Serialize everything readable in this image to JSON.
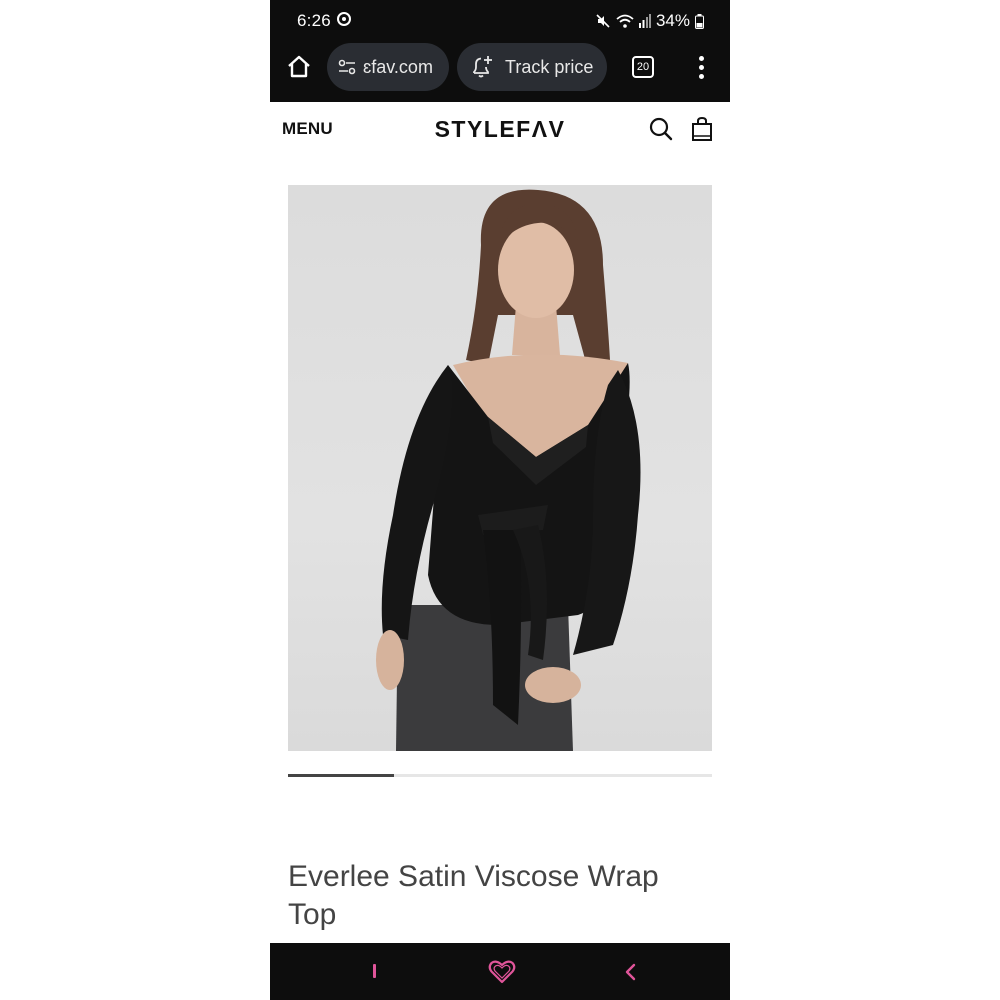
{
  "status_bar": {
    "time": "6:26",
    "battery": "34%"
  },
  "browser": {
    "url": "ɛfav.com",
    "track_price_label": "Track price",
    "tab_count": "20"
  },
  "site": {
    "menu_label": "MENU",
    "logo": "STYLEFΛV"
  },
  "product": {
    "title": "Everlee Satin Viscose Wrap Top",
    "carousel_progress": 0.25
  },
  "icons": {
    "status": [
      "sync-icon",
      "mute-icon",
      "wifi-icon",
      "signal-icon",
      "battery-icon"
    ],
    "browser": [
      "home-icon",
      "site-settings-icon",
      "bell-plus-icon",
      "tabs-icon",
      "more-icon"
    ],
    "site": [
      "search-icon",
      "bag-icon"
    ],
    "nav": [
      "recents-icon",
      "heart-home-icon",
      "back-icon"
    ]
  },
  "colors": {
    "dark_bar": "#0d0d0d",
    "pill": "#2a2d33",
    "nav_accent": "#e0559a"
  }
}
